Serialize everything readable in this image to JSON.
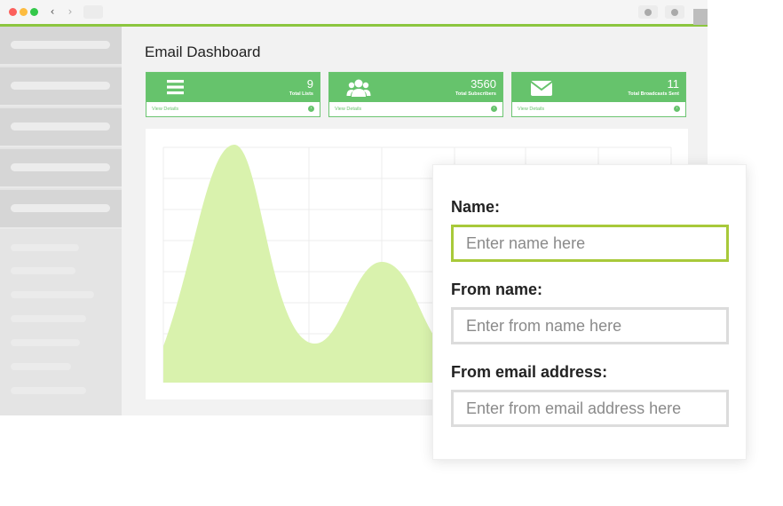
{
  "page": {
    "title": "Email Dashboard"
  },
  "browser": {
    "icons": [
      "close-dot",
      "minimize-dot",
      "maximize-dot",
      "back-icon",
      "forward-icon"
    ],
    "back_glyph": "‹",
    "forward_glyph": "›"
  },
  "stats": [
    {
      "icon": "list-icon",
      "value": "9",
      "caption": "Total Lists",
      "link": "View Details"
    },
    {
      "icon": "users-icon",
      "value": "3560",
      "caption": "Total Subscribers",
      "link": "View Details"
    },
    {
      "icon": "envelope-icon",
      "value": "11",
      "caption": "Total Broadcasts Sent",
      "link": "View Details"
    }
  ],
  "form": {
    "name_label": "Name:",
    "name_placeholder": "Enter name here",
    "from_name_label": "From name:",
    "from_name_placeholder": "Enter from name here",
    "from_email_label": "From email address:",
    "from_email_placeholder": "Enter from email address here"
  },
  "colors": {
    "accent": "#8cc63f",
    "card_green": "#66c36c",
    "chart_fill": "#d9f2ad",
    "active_border": "#a8c93a"
  }
}
